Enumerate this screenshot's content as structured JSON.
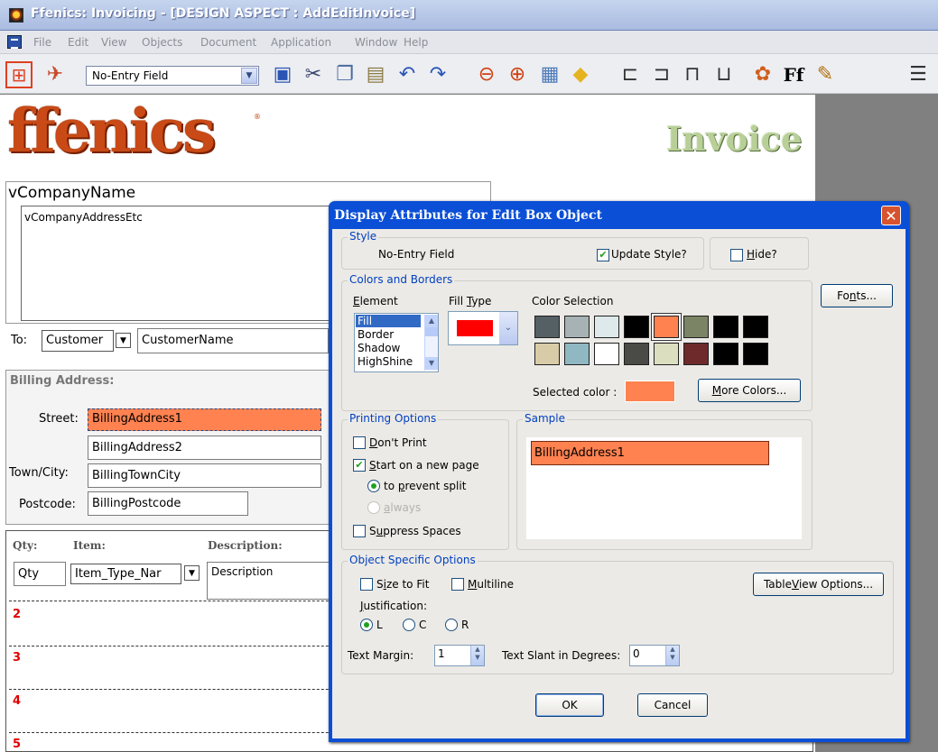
{
  "window": {
    "title": "Ffenics: Invoicing - [DESIGN ASPECT : AddEditInvoice]"
  },
  "menu": [
    "File",
    "Edit",
    "View",
    "Objects",
    "Document",
    "Application",
    "Window",
    "Help"
  ],
  "toolbar": {
    "style_value": "No-Entry Field",
    "text_icon": "Ff"
  },
  "form": {
    "logo": "ffenics",
    "logo_mark": "®",
    "title": "Invoice",
    "company_name": "vCompanyName",
    "company_address": "vCompanyAddressEtc",
    "to_label": "To:",
    "customer_type": "Customer",
    "customer_name": "CustomerName",
    "billing_heading": "Billing Address:",
    "street_label": "Street:",
    "billing_address1": "BillingAddress1",
    "billing_address2": "BillingAddress2",
    "town_label": "Town/City:",
    "town_value": "BillingTownCity",
    "postcode_label": "Postcode:",
    "postcode_value": "BillingPostcode",
    "col_qty": "Qty:",
    "col_item": "Item:",
    "col_desc": "Description:",
    "qty_field": "Qty",
    "item_field": "Item_Type_Nar",
    "desc_field": "Description",
    "row_numbers": [
      "2",
      "3",
      "4",
      "5"
    ]
  },
  "dialog": {
    "title": "Display Attributes for Edit Box Object",
    "style_group": "Style",
    "style_value": "No-Entry Field",
    "update_style": "Update Style?",
    "hide": "Hide?",
    "colors_group": "Colors and Borders",
    "element_label": "Element",
    "element_items": [
      "Fill",
      "Border",
      "Shadow",
      "HighShine"
    ],
    "fill_type_label": "Fill Type",
    "color_selection_label": "Color Selection",
    "swatch_colors": [
      "#556064",
      "#a7b2b4",
      "#dde9ea",
      "#000000",
      "#ff8250",
      "#7b8565",
      "#000000",
      "#000000",
      "#d8cca8",
      "#8fb8c2",
      "#ffffff",
      "#4a4a46",
      "#dcdfbf",
      "#6e2a2a",
      "#000000",
      "#000000"
    ],
    "fill_color": "#ff0000",
    "selected_color_label": "Selected color :",
    "selected_color": "#ff8250",
    "more_colors": "More Colors...",
    "fonts": "Fonts...",
    "printing_group": "Printing Options",
    "dont_print": "Don't Print",
    "start_new_page": "Start on a new page",
    "prevent_split": "to prevent split",
    "always": "always",
    "suppress_spaces": "Suppress Spaces",
    "sample_group": "Sample",
    "sample_text": "BillingAddress1",
    "object_group": "Object Specific Options",
    "size_to_fit": "Size to Fit",
    "multiline": "Multiline",
    "tableview": "TableView Options...",
    "justification_label": "Justification:",
    "just_l": "L",
    "just_c": "C",
    "just_r": "R",
    "text_margin_label": "Text Margin:",
    "text_margin": "1",
    "text_slant_label": "Text Slant in Degrees:",
    "text_slant": "0",
    "ok": "OK",
    "cancel": "Cancel"
  }
}
